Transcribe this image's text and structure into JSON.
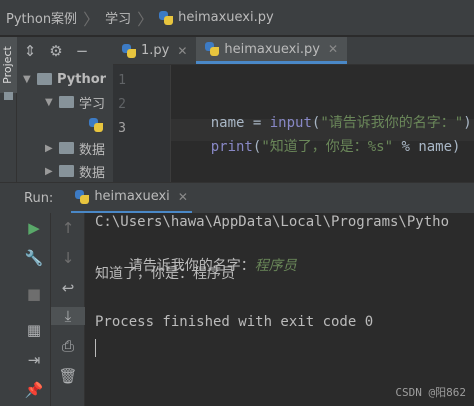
{
  "breadcrumb": {
    "project": "Python案例",
    "folder": "学习",
    "file": "heimaxuexi.py"
  },
  "sidebar": {
    "project_tab_label": "Project"
  },
  "project_tree": {
    "root_label": "Pythor",
    "child_folder_label": "学习",
    "item_a_label": "数据",
    "item_b_label": "数据"
  },
  "editor_tabs": [
    {
      "label": "1.py"
    },
    {
      "label": "heimaxuexi.py"
    }
  ],
  "editor": {
    "line_numbers": [
      "1",
      "2",
      "3"
    ],
    "line2": {
      "var": "name",
      "eq": " = ",
      "func": "input",
      "open": "(",
      "str": "\"请告诉我你的名字：\"",
      "close": ")"
    },
    "line3": {
      "func": "print",
      "open": "(",
      "str": "\"知道了，你是：%s\"",
      "op": " % ",
      "var": "name",
      "close": ")"
    }
  },
  "run_panel": {
    "label": "Run:",
    "tab_label": "heimaxuexi"
  },
  "console": {
    "path_line": "C:\\Users\\hawa\\AppData\\Local\\Programs\\Pytho",
    "prompt": "请告诉我你的名字：",
    "user_input": "程序员",
    "output": "知道了，你是：程序员",
    "exit_line": "Process finished with exit code 0"
  },
  "watermark": "CSDN @阳862",
  "colors": {
    "accent": "#4a88c7",
    "run_green": "#59a869",
    "string_green": "#6a8759"
  }
}
